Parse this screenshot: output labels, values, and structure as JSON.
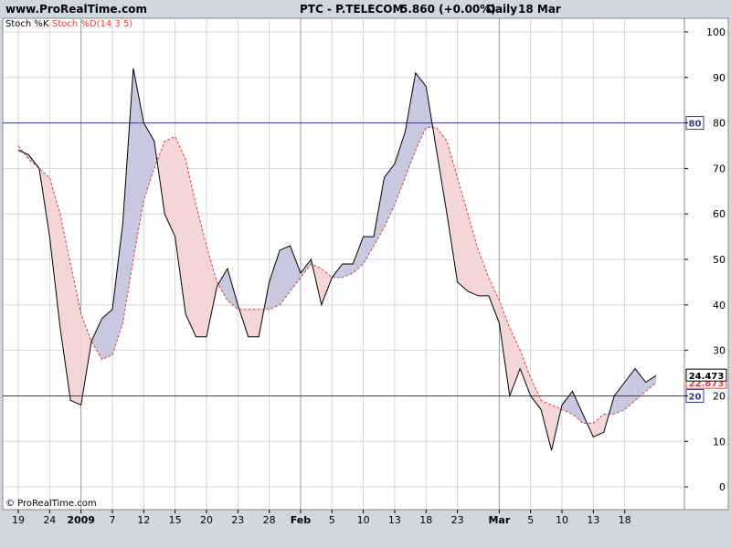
{
  "header": {
    "site": "www.ProRealTime.com",
    "instrument": "PTC - P.TELECOM",
    "quote": "5.860 (+0.00%)",
    "period": "Daily",
    "date": "18 Mar"
  },
  "legend": {
    "k_label": "Stoch %K",
    "d_label": "Stoch %D(14 3 5)"
  },
  "copyright": "© ProRealTime.com",
  "colors": {
    "k_line": "#000000",
    "d_line": "#e04040",
    "fill_k_above": "#c8c8e0",
    "fill_d_above": "#f5d6d6",
    "level_line": "#3a3a8a",
    "grid": "#d4d4d4",
    "background": "#ffffff",
    "frame": "#cfd8e0"
  },
  "chart_data": {
    "type": "line",
    "title": "PTC - P.TELECOM  5.860 (+0.00%)  Daily  18 Mar",
    "ylim": [
      -5,
      103
    ],
    "yticks": [
      0,
      10,
      20,
      30,
      40,
      50,
      60,
      70,
      80,
      90,
      100
    ],
    "levels": [
      {
        "value": 80,
        "label": "80"
      },
      {
        "value": 20,
        "label": "20"
      }
    ],
    "x_ticks": [
      {
        "index": 0,
        "label": "19"
      },
      {
        "index": 3,
        "label": "24"
      },
      {
        "index": 6,
        "label": "2009",
        "bold": true
      },
      {
        "index": 9,
        "label": "7"
      },
      {
        "index": 12,
        "label": "12"
      },
      {
        "index": 15,
        "label": "15"
      },
      {
        "index": 18,
        "label": "20"
      },
      {
        "index": 21,
        "label": "23"
      },
      {
        "index": 24,
        "label": "28"
      },
      {
        "index": 27,
        "label": "Feb",
        "bold": true
      },
      {
        "index": 30,
        "label": "5"
      },
      {
        "index": 33,
        "label": "10"
      },
      {
        "index": 36,
        "label": "13"
      },
      {
        "index": 39,
        "label": "18"
      },
      {
        "index": 42,
        "label": "23"
      },
      {
        "index": 46,
        "label": "Mar",
        "bold": true
      },
      {
        "index": 49,
        "label": "5"
      },
      {
        "index": 52,
        "label": "10"
      },
      {
        "index": 55,
        "label": "13"
      },
      {
        "index": 58,
        "label": "18"
      }
    ],
    "x_major": [
      6,
      27,
      46
    ],
    "series": [
      {
        "name": "Stoch %K",
        "last_value": "24.473",
        "values": [
          74,
          73,
          70,
          55,
          35,
          19,
          18,
          32,
          37,
          39,
          58,
          92,
          80,
          76,
          60,
          55,
          38,
          33,
          33,
          44,
          48,
          40,
          33,
          33,
          45,
          52,
          53,
          47,
          50,
          40,
          46,
          49,
          49,
          55,
          55,
          68,
          71,
          78,
          91,
          88,
          74,
          60,
          45,
          43,
          42,
          42,
          36,
          20,
          26,
          20,
          17,
          8,
          18,
          21,
          16,
          11,
          12,
          20,
          23,
          26,
          23,
          24.473
        ]
      },
      {
        "name": "Stoch %D",
        "last_value": "22.873",
        "values": [
          75,
          72,
          70,
          68,
          60,
          49,
          38,
          32,
          28,
          29,
          36,
          50,
          63,
          70,
          76,
          77,
          72,
          62,
          53,
          45,
          41,
          39,
          39,
          39,
          39,
          40,
          43,
          46,
          49,
          48,
          46,
          46,
          47,
          49,
          53,
          57,
          62,
          68,
          74,
          79,
          79,
          76,
          68,
          60,
          52,
          46,
          41,
          35,
          30,
          24,
          19,
          18,
          17,
          16,
          14,
          14,
          16,
          16,
          17,
          19,
          21,
          22.873
        ]
      }
    ],
    "grid": true
  }
}
